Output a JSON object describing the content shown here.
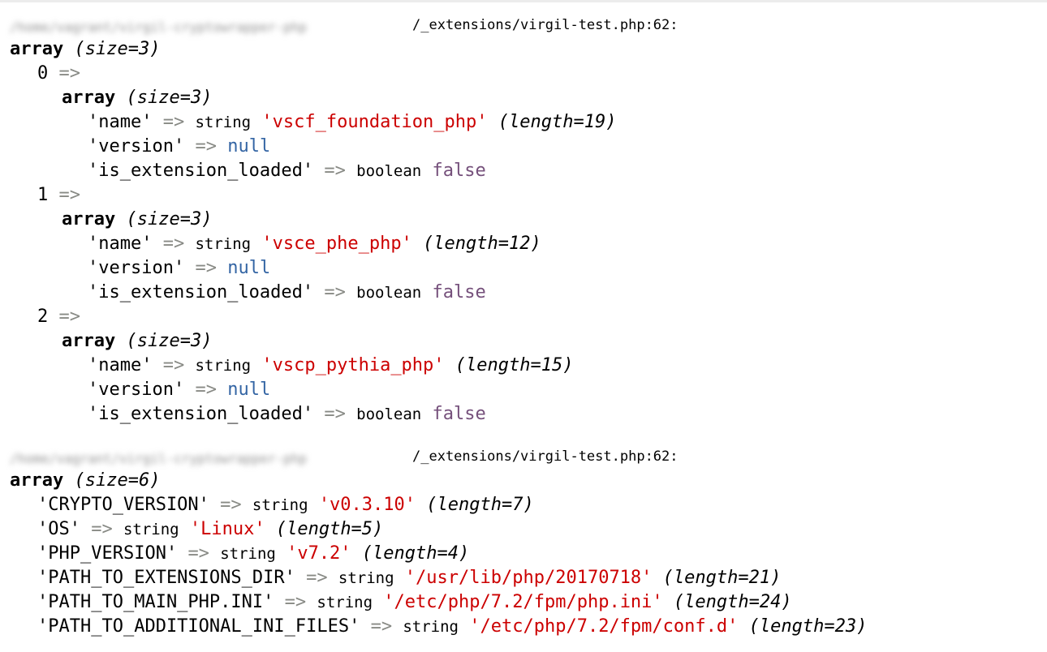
{
  "colors": {
    "string_value": "#cc0000",
    "null_value": "#3465a4",
    "bool_value": "#75507b",
    "arrow": "#888a85"
  },
  "dump1": {
    "file_path_blurred": "/home/vagrant/virgil-cryptowrapper-php",
    "file_suffix": "/_extensions/virgil-test.php:62:",
    "array_label": "array",
    "size_label": "(size=3)",
    "items": [
      {
        "index": "0",
        "arrow": "=>",
        "array_label": "array",
        "size_label": "(size=3)",
        "name_key": "'name'",
        "name_arrow": "=>",
        "name_type": "string",
        "name_value": "'vscf_foundation_php'",
        "name_length": "(length=19)",
        "version_key": "'version'",
        "version_arrow": "=>",
        "version_value": "null",
        "loaded_key": "'is_extension_loaded'",
        "loaded_arrow": "=>",
        "loaded_type": "boolean",
        "loaded_value": "false"
      },
      {
        "index": "1",
        "arrow": "=>",
        "array_label": "array",
        "size_label": "(size=3)",
        "name_key": "'name'",
        "name_arrow": "=>",
        "name_type": "string",
        "name_value": "'vsce_phe_php'",
        "name_length": "(length=12)",
        "version_key": "'version'",
        "version_arrow": "=>",
        "version_value": "null",
        "loaded_key": "'is_extension_loaded'",
        "loaded_arrow": "=>",
        "loaded_type": "boolean",
        "loaded_value": "false"
      },
      {
        "index": "2",
        "arrow": "=>",
        "array_label": "array",
        "size_label": "(size=3)",
        "name_key": "'name'",
        "name_arrow": "=>",
        "name_type": "string",
        "name_value": "'vscp_pythia_php'",
        "name_length": "(length=15)",
        "version_key": "'version'",
        "version_arrow": "=>",
        "version_value": "null",
        "loaded_key": "'is_extension_loaded'",
        "loaded_arrow": "=>",
        "loaded_type": "boolean",
        "loaded_value": "false"
      }
    ]
  },
  "dump2": {
    "file_path_blurred": "/home/vagrant/virgil-cryptowrapper-php",
    "file_suffix": "/_extensions/virgil-test.php:62:",
    "array_label": "array",
    "size_label": "(size=6)",
    "entries": [
      {
        "key": "'CRYPTO_VERSION'",
        "arrow": "=>",
        "type": "string",
        "value": "'v0.3.10'",
        "length": "(length=7)"
      },
      {
        "key": "'OS'",
        "arrow": "=>",
        "type": "string",
        "value": "'Linux'",
        "length": "(length=5)"
      },
      {
        "key": "'PHP_VERSION'",
        "arrow": "=>",
        "type": "string",
        "value": "'v7.2'",
        "length": "(length=4)"
      },
      {
        "key": "'PATH_TO_EXTENSIONS_DIR'",
        "arrow": "=>",
        "type": "string",
        "value": "'/usr/lib/php/20170718'",
        "length": "(length=21)"
      },
      {
        "key": "'PATH_TO_MAIN_PHP.INI'",
        "arrow": "=>",
        "type": "string",
        "value": "'/etc/php/7.2/fpm/php.ini'",
        "length": "(length=24)"
      },
      {
        "key": "'PATH_TO_ADDITIONAL_INI_FILES'",
        "arrow": "=>",
        "type": "string",
        "value": "'/etc/php/7.2/fpm/conf.d'",
        "length": "(length=23)"
      }
    ]
  }
}
